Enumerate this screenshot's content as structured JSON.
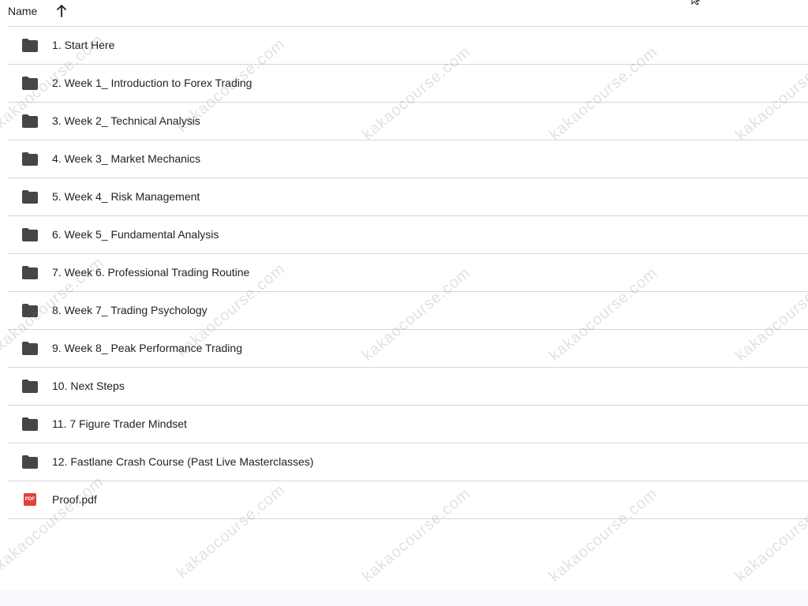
{
  "header": {
    "name_label": "Name",
    "sort_icon": "arrow-up-icon"
  },
  "files": [
    {
      "label": "1. Start Here",
      "type": "folder"
    },
    {
      "label": "2. Week 1_ Introduction to Forex Trading",
      "type": "folder"
    },
    {
      "label": "3. Week 2_ Technical Analysis",
      "type": "folder"
    },
    {
      "label": "4. Week 3_ Market Mechanics",
      "type": "folder"
    },
    {
      "label": "5. Week 4_ Risk Management",
      "type": "folder"
    },
    {
      "label": "6. Week 5_ Fundamental Analysis",
      "type": "folder"
    },
    {
      "label": "7. Week 6. Professional Trading Routine",
      "type": "folder"
    },
    {
      "label": "8. Week 7_ Trading Psychology",
      "type": "folder"
    },
    {
      "label": "9. Week 8_ Peak Performance Trading",
      "type": "folder"
    },
    {
      "label": "10. Next Steps",
      "type": "folder"
    },
    {
      "label": "11. 7 Figure Trader Mindset",
      "type": "folder"
    },
    {
      "label": "12. Fastlane Crash Course (Past Live Masterclasses)",
      "type": "folder"
    },
    {
      "label": "Proof.pdf",
      "type": "pdf",
      "badge": "PDF"
    }
  ],
  "watermark": {
    "text": "kakaocourse.com",
    "color": "#787878"
  },
  "colors": {
    "folder": "#444746",
    "pdf": "#e0413b",
    "divider": "#d6d6d6"
  }
}
